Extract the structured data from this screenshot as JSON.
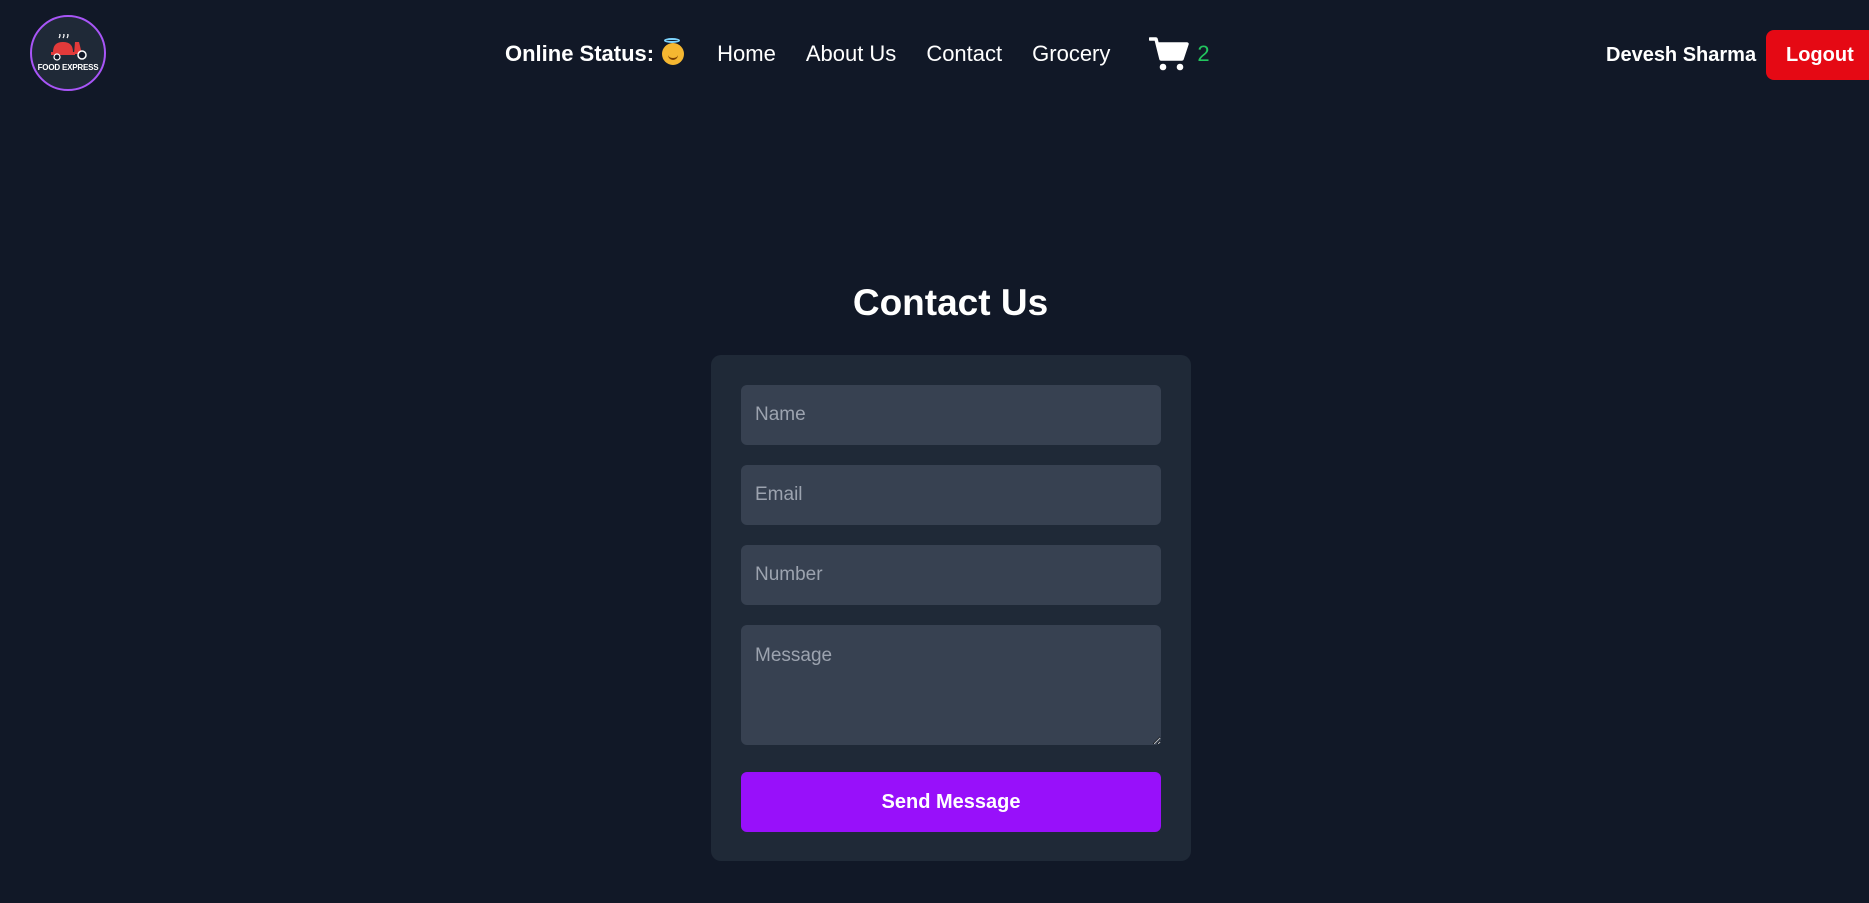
{
  "header": {
    "logo_text": "FOOD EXPRESS",
    "status_label": "Online Status:",
    "status_icon": "smiling-face-with-halo-icon",
    "nav": [
      {
        "label": "Home"
      },
      {
        "label": "About Us"
      },
      {
        "label": "Contact"
      },
      {
        "label": "Grocery"
      }
    ],
    "cart_icon": "shopping-cart-icon",
    "cart_count": "2",
    "user_name": "Devesh Sharma",
    "logout_label": "Logout"
  },
  "contact": {
    "title": "Contact Us",
    "name_placeholder": "Name",
    "email_placeholder": "Email",
    "number_placeholder": "Number",
    "message_placeholder": "Message",
    "submit_label": "Send Message"
  },
  "colors": {
    "background": "#111827",
    "card": "#1f2937",
    "input": "#374151",
    "accent": "#9810fa",
    "logout": "#e50914",
    "cart_count": "#22c55e",
    "logo_border": "#a855f7"
  }
}
